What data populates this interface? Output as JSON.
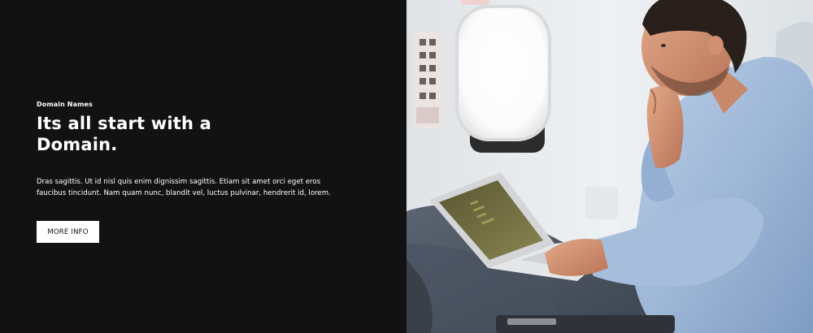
{
  "hero": {
    "eyebrow": "Domain Names",
    "headline": "Its all start with a Domain.",
    "body": "Dras sagittis. Ut id nisl quis enim dignissim sagittis. Etiam sit amet orci eget eros faucibus tincidunt. Nam quam nunc, blandit vel, luctus pulvinar, hendrerit id, lorem.",
    "button_label": "MORE INFO"
  },
  "colors": {
    "background": "#121212",
    "text": "#ffffff",
    "button_bg": "#ffffff",
    "button_text": "#111111"
  }
}
